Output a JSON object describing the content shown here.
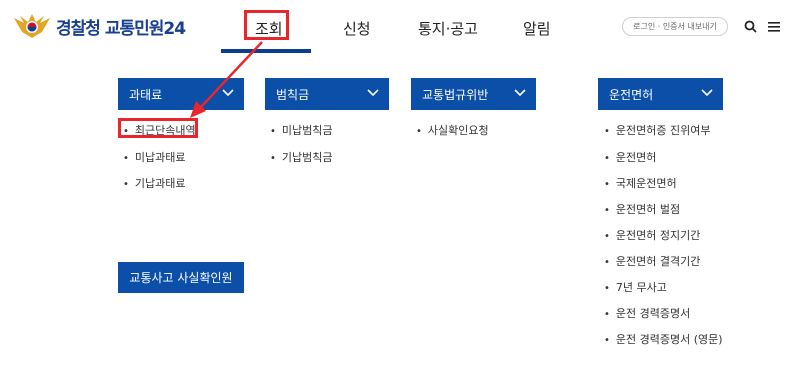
{
  "header": {
    "logo_text": "경찰청 교통민원24",
    "nav": [
      {
        "label": "조회"
      },
      {
        "label": "신청"
      },
      {
        "label": "통지·공고"
      },
      {
        "label": "알림"
      }
    ],
    "login_text": "로그인 · 인증서 내보내기"
  },
  "icons": {
    "search": "search-icon",
    "menu": "hamburger-menu-icon",
    "chevron": "chevron-down-icon"
  },
  "colors": {
    "primary": "#0b4fa8",
    "highlight": "#e8262c",
    "brand_text": "#1a3f8f"
  },
  "categories": [
    {
      "title": "과태료",
      "items": [
        "최근단속내역",
        "미납과태료",
        "기납과태료"
      ]
    },
    {
      "title": "범칙금",
      "items": [
        "미납범칙금",
        "기납범칙금"
      ]
    },
    {
      "title": "교통법규위반",
      "items": [
        "사실확인요청"
      ]
    },
    {
      "title": "운전면허",
      "items": [
        "운전면허증 진위여부",
        "운전면허",
        "국제운전면허",
        "운전면허 벌점",
        "운전면허 정지기간",
        "운전면허 결격기간",
        "7년 무사고",
        "운전 경력증명서",
        "운전 경력증명서 (영문)"
      ]
    }
  ],
  "accident_button": "교통사고 사실확인원"
}
